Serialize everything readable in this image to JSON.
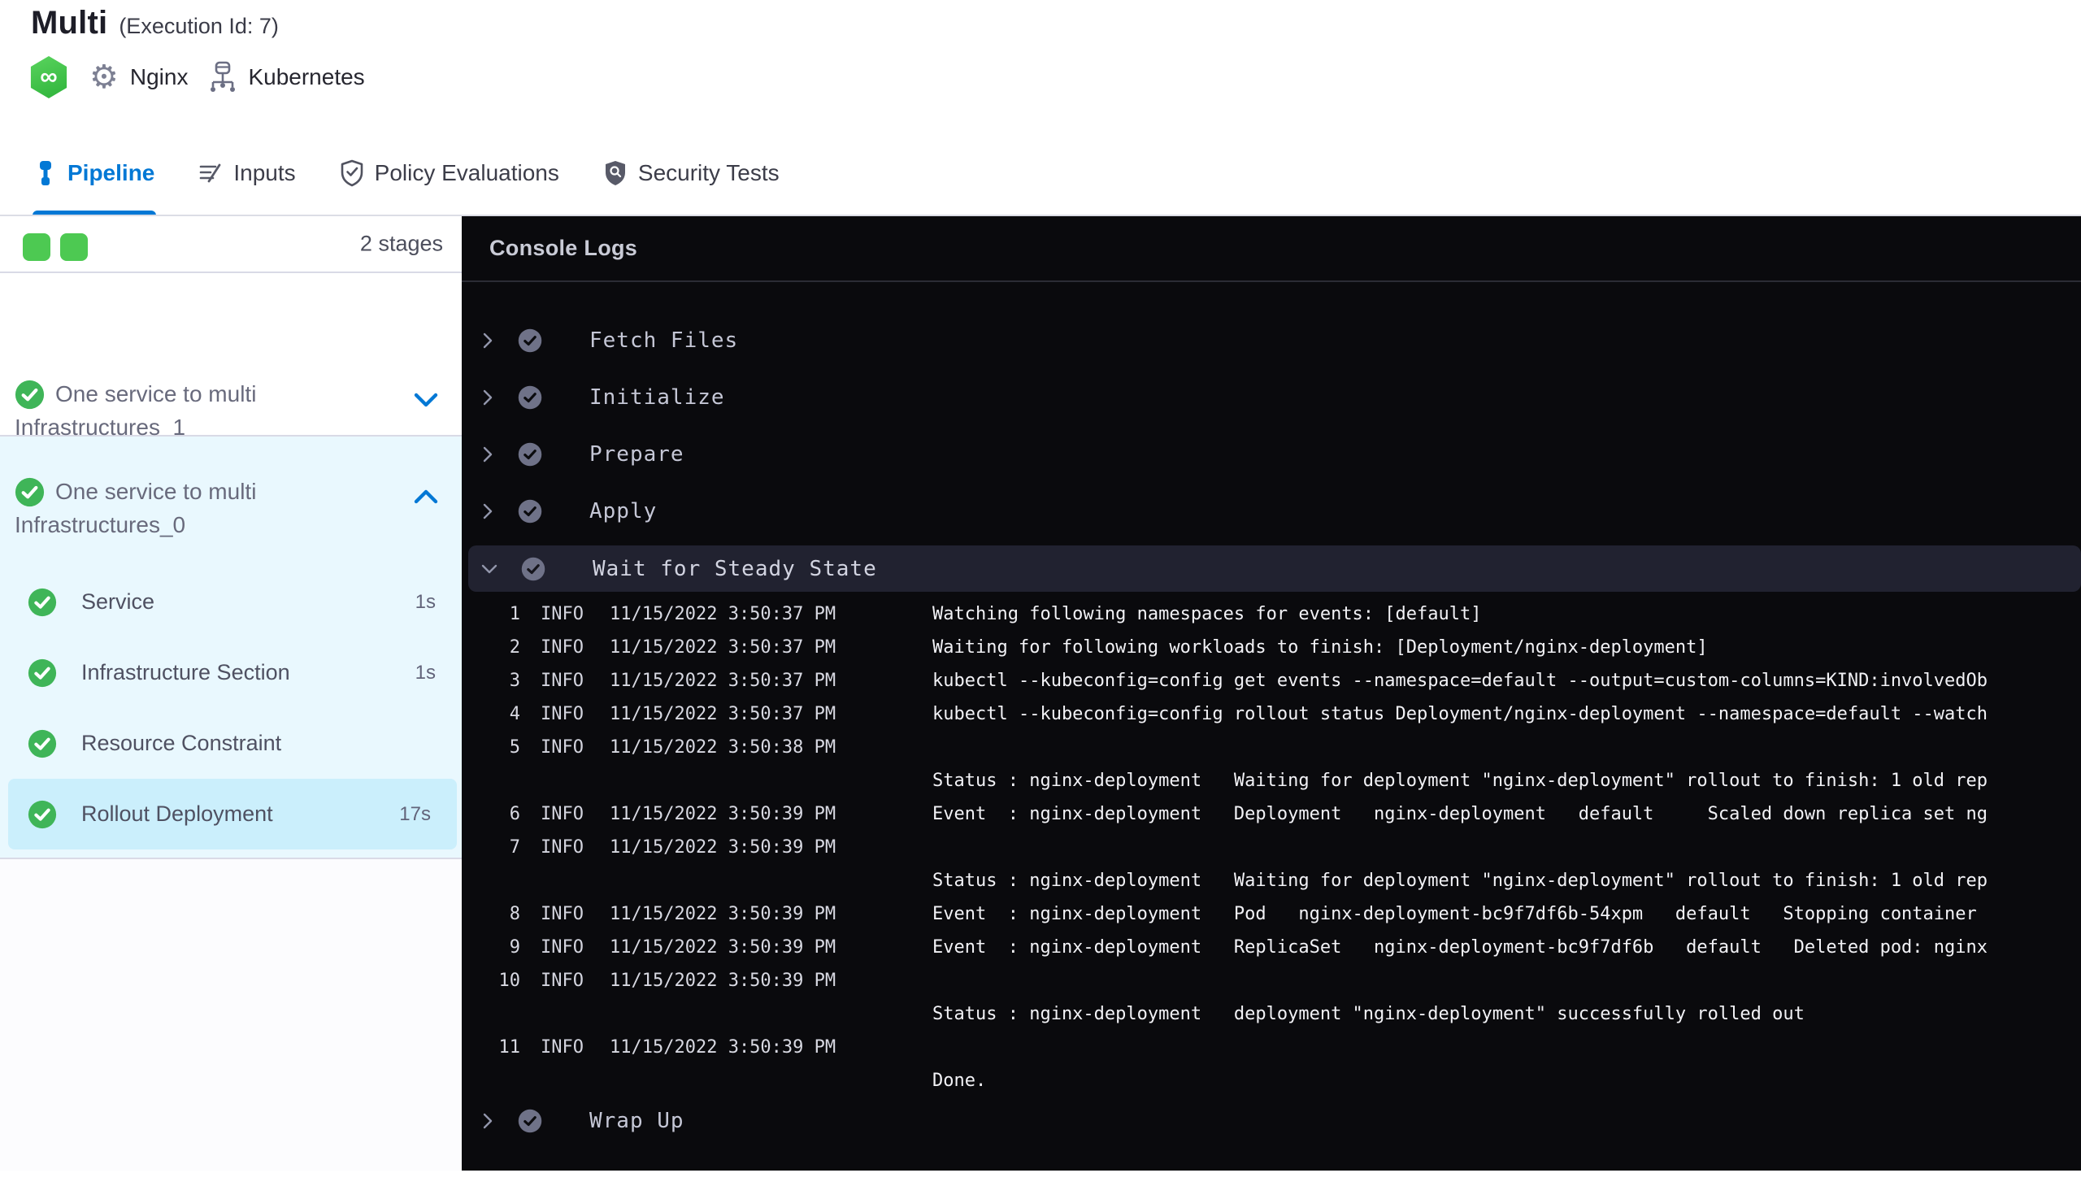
{
  "header": {
    "title": "Multi",
    "execution_id_label": "(Execution Id: 7)",
    "service_label": "Nginx",
    "infrastructure_label": "Kubernetes",
    "harness_icon_glyph": "∞",
    "gear_icon_glyph": "⚙"
  },
  "tabs": [
    {
      "label": "Pipeline",
      "active": true
    },
    {
      "label": "Inputs",
      "active": false
    },
    {
      "label": "Policy Evaluations",
      "active": false
    },
    {
      "label": "Security Tests",
      "active": false
    }
  ],
  "sidebar": {
    "stages_count_label": "2 stages",
    "stage_indicator_count": 2,
    "groups": [
      {
        "title": "One service to multi Infrastructures_1",
        "status": "success",
        "expanded": false
      },
      {
        "title": "One service to multi Infrastructures_0",
        "status": "success",
        "expanded": true
      }
    ],
    "steps": [
      {
        "label": "Service",
        "duration": "1s",
        "selected": false
      },
      {
        "label": "Infrastructure Section",
        "duration": "1s",
        "selected": false
      },
      {
        "label": "Resource Constraint",
        "duration": "",
        "selected": false
      },
      {
        "label": "Rollout Deployment",
        "duration": "17s",
        "selected": true
      }
    ]
  },
  "console": {
    "title": "Console Logs",
    "steps_before": [
      {
        "label": "Fetch Files"
      },
      {
        "label": "Initialize"
      },
      {
        "label": "Prepare"
      },
      {
        "label": "Apply"
      }
    ],
    "expanded_step": {
      "label": "Wait for Steady State"
    },
    "steps_after": [
      {
        "label": "Wrap Up"
      }
    ],
    "log_rows": [
      {
        "num": "1",
        "level": "INFO",
        "time": "11/15/2022 3:50:37 PM",
        "msg": "Watching following namespaces for events: [default]"
      },
      {
        "num": "2",
        "level": "INFO",
        "time": "11/15/2022 3:50:37 PM",
        "msg": "Waiting for following workloads to finish: [Deployment/nginx-deployment]"
      },
      {
        "num": "3",
        "level": "INFO",
        "time": "11/15/2022 3:50:37 PM",
        "msg": "kubectl --kubeconfig=config get events --namespace=default --output=custom-columns=KIND:involvedOb"
      },
      {
        "num": "4",
        "level": "INFO",
        "time": "11/15/2022 3:50:37 PM",
        "msg": "kubectl --kubeconfig=config rollout status Deployment/nginx-deployment --namespace=default --watch"
      },
      {
        "num": "5",
        "level": "INFO",
        "time": "11/15/2022 3:50:38 PM",
        "msg": ""
      },
      {
        "num": "",
        "level": "",
        "time": "",
        "msg": "Status : nginx-deployment   Waiting for deployment \"nginx-deployment\" rollout to finish: 1 old rep"
      },
      {
        "num": "6",
        "level": "INFO",
        "time": "11/15/2022 3:50:39 PM",
        "msg": "Event  : nginx-deployment   Deployment   nginx-deployment   default     Scaled down replica set ng"
      },
      {
        "num": "7",
        "level": "INFO",
        "time": "11/15/2022 3:50:39 PM",
        "msg": ""
      },
      {
        "num": "",
        "level": "",
        "time": "",
        "msg": "Status : nginx-deployment   Waiting for deployment \"nginx-deployment\" rollout to finish: 1 old rep"
      },
      {
        "num": "8",
        "level": "INFO",
        "time": "11/15/2022 3:50:39 PM",
        "msg": "Event  : nginx-deployment   Pod   nginx-deployment-bc9f7df6b-54xpm   default   Stopping container"
      },
      {
        "num": "9",
        "level": "INFO",
        "time": "11/15/2022 3:50:39 PM",
        "msg": "Event  : nginx-deployment   ReplicaSet   nginx-deployment-bc9f7df6b   default   Deleted pod: nginx"
      },
      {
        "num": "10",
        "level": "INFO",
        "time": "11/15/2022 3:50:39 PM",
        "msg": ""
      },
      {
        "num": "",
        "level": "",
        "time": "",
        "msg": "Status : nginx-deployment   deployment \"nginx-deployment\" successfully rolled out"
      },
      {
        "num": "11",
        "level": "INFO",
        "time": "11/15/2022 3:50:39 PM",
        "msg": ""
      },
      {
        "num": "",
        "level": "",
        "time": "",
        "msg": "Done."
      }
    ]
  },
  "colors": {
    "accent_blue": "#0278d5",
    "success_green": "#4dc952",
    "console_bg": "#0a0a0d",
    "selected_step_bg": "#cbeffc",
    "selected_group_bg": "#e9f8fe"
  }
}
